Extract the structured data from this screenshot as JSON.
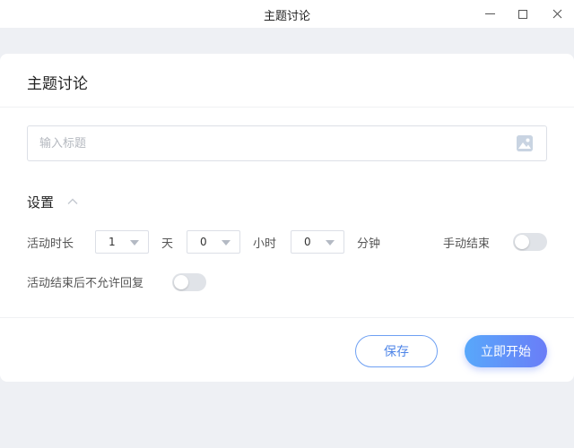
{
  "window": {
    "title": "主题讨论",
    "controls": [
      "minimize-icon",
      "maximize-icon",
      "close-icon"
    ]
  },
  "panel": {
    "title": "主题讨论",
    "title_input": {
      "placeholder": "输入标题",
      "value": "",
      "icon": "image-icon"
    }
  },
  "settings": {
    "label": "设置",
    "expanded": true,
    "duration": {
      "label": "活动时长",
      "days": {
        "value": "1",
        "unit": "天"
      },
      "hours": {
        "value": "0",
        "unit": "小时"
      },
      "minutes": {
        "value": "0",
        "unit": "分钟"
      }
    },
    "manual_end": {
      "label": "手动结束",
      "on": false
    },
    "no_reply_after_end": {
      "label": "活动结束后不允许回复",
      "on": false
    }
  },
  "actions": {
    "save_label": "保存",
    "start_label": "立即开始"
  },
  "colors": {
    "accent": "#4f86e8",
    "gradient_start": "#58a8fb",
    "gradient_end": "#6a7df7",
    "toggle_off": "#e0e3e8",
    "background": "#eef0f4"
  }
}
